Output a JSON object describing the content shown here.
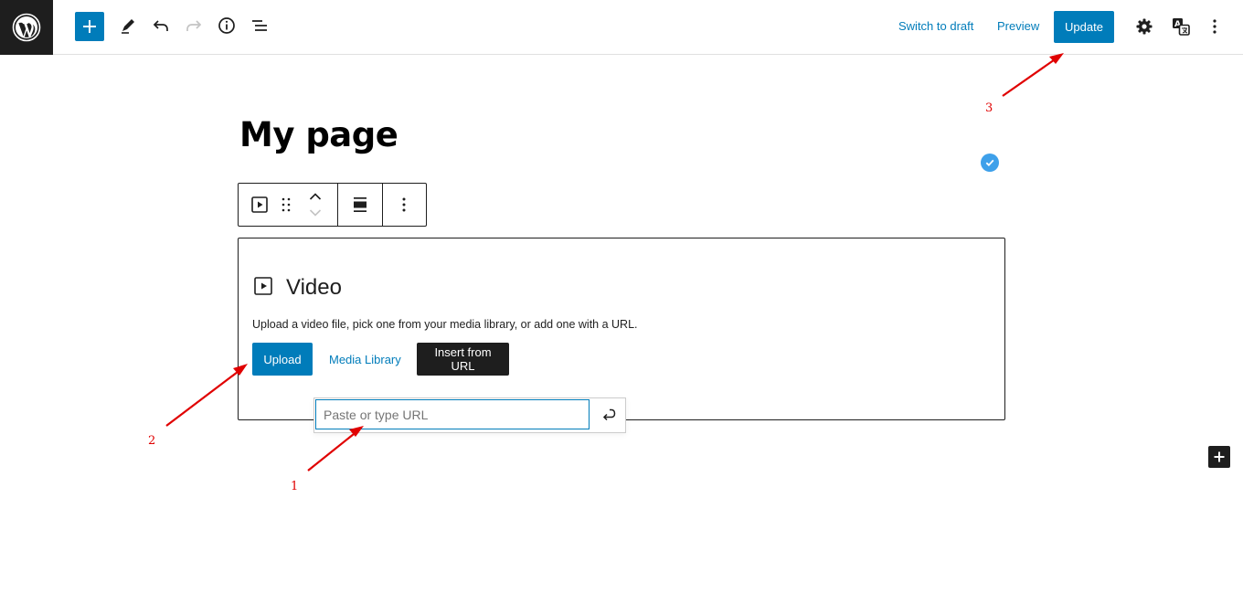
{
  "topbar": {
    "switch_to_draft": "Switch to draft",
    "preview": "Preview",
    "update": "Update"
  },
  "editor": {
    "title": "My page"
  },
  "video_block": {
    "title": "Video",
    "instructions": "Upload a video file, pick one from your media library, or add one with a URL.",
    "upload_label": "Upload",
    "media_library_label": "Media Library",
    "insert_from_url_label": "Insert from URL"
  },
  "url_popover": {
    "placeholder": "Paste or type URL",
    "value": ""
  },
  "annotations": {
    "labels": [
      "1",
      "2",
      "3"
    ]
  },
  "colors": {
    "accent": "#007cba",
    "dark": "#1e1e1e",
    "annotation": "#e00000",
    "check": "#3ea0ea"
  },
  "icons": {
    "logo": "wordpress-logo-icon",
    "inserter": "plus-icon",
    "tools": "pencil-icon",
    "undo": "undo-icon",
    "redo": "redo-icon",
    "details": "info-icon",
    "list_view": "list-view-icon",
    "settings": "gear-icon",
    "translate": "translate-icon",
    "options": "more-vertical-icon"
  }
}
